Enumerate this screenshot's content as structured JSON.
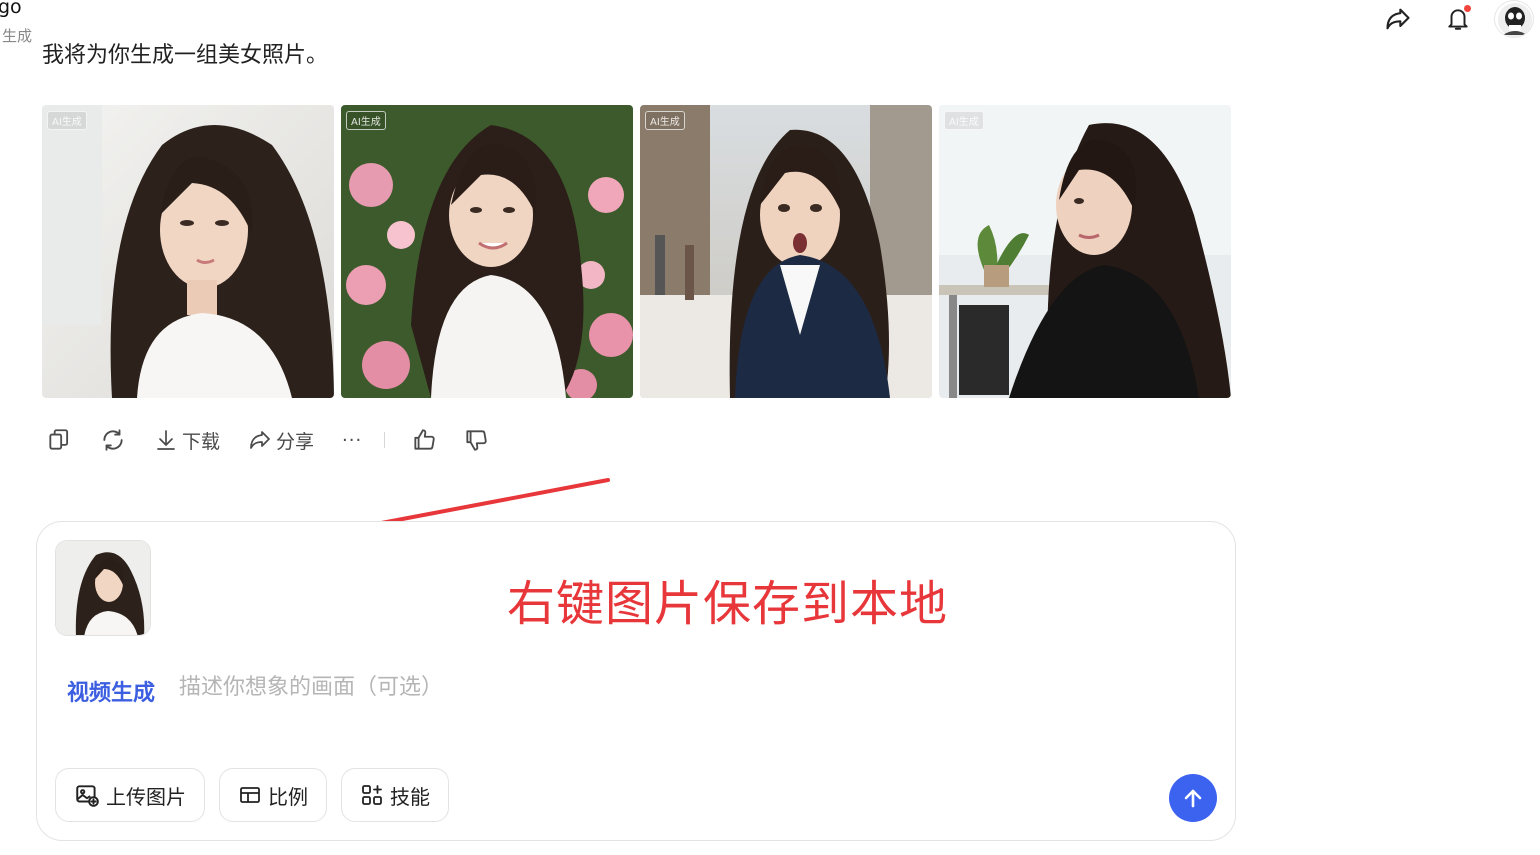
{
  "header": {
    "title": "go",
    "subtitle": "生成",
    "share_icon": "share-icon",
    "bell_icon": "bell-icon",
    "notification_dot_color": "#f2443a"
  },
  "message": {
    "partial_text": "我将为你生成一组美女照片。"
  },
  "gallery": {
    "images": [
      {
        "badge": "AI生成",
        "scene": "woman in white dress, bright room"
      },
      {
        "badge": "AI生成",
        "scene": "woman among pink roses"
      },
      {
        "badge": "AI生成",
        "scene": "surprised woman in denim jacket on street"
      },
      {
        "badge": "AI生成",
        "scene": "woman in black blazer in office"
      }
    ]
  },
  "actions": {
    "copy_icon": "copy-icon",
    "regenerate_icon": "refresh-icon",
    "download_label": "下载",
    "share_label": "分享",
    "more_label": "···",
    "like_icon": "thumbs-up-icon",
    "dislike_icon": "thumbs-down-icon"
  },
  "annotation": {
    "text": "右键图片保存到本地",
    "color": "#e8373a"
  },
  "composer": {
    "mode_label": "视频生成",
    "placeholder": "描述你想象的画面（可选）",
    "value": "",
    "upload_label": "上传图片",
    "ratio_label": "比例",
    "skills_label": "技能",
    "send_color": "#3c63f0"
  }
}
